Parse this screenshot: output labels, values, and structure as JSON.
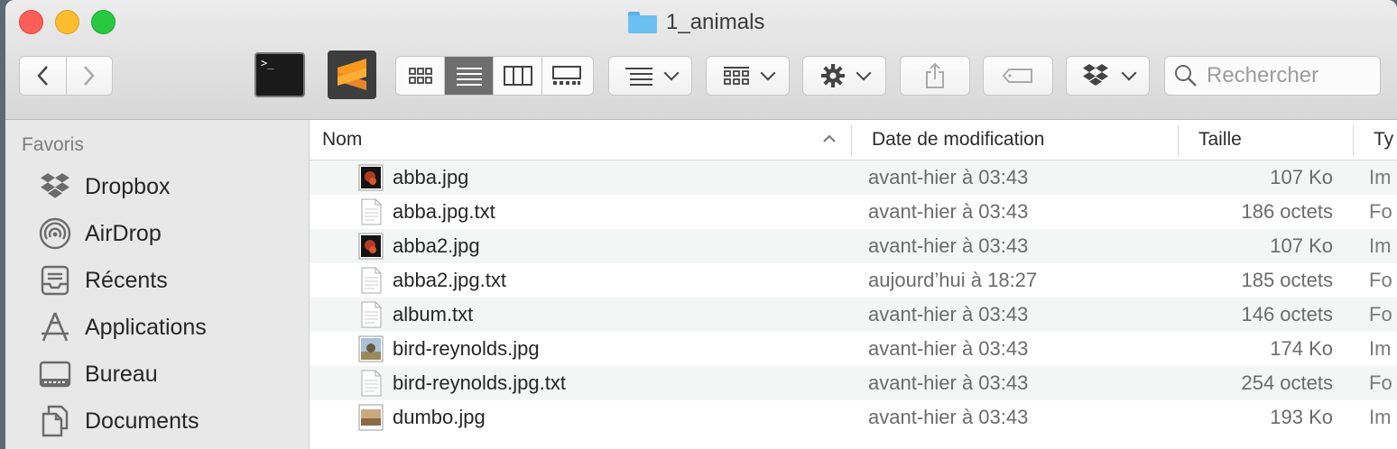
{
  "window": {
    "title": "1_animals"
  },
  "toolbar": {
    "back_label": "‹",
    "forward_label": "›",
    "terminal_prompt": ">_",
    "search_placeholder": "Rechercher"
  },
  "sidebar": {
    "heading": "Favoris",
    "items": [
      {
        "label": "Dropbox",
        "icon": "dropbox-icon"
      },
      {
        "label": "AirDrop",
        "icon": "airdrop-icon"
      },
      {
        "label": "Récents",
        "icon": "recents-icon"
      },
      {
        "label": "Applications",
        "icon": "applications-icon"
      },
      {
        "label": "Bureau",
        "icon": "desktop-icon"
      },
      {
        "label": "Documents",
        "icon": "documents-icon"
      }
    ]
  },
  "columns": {
    "name": "Nom",
    "date": "Date de modification",
    "size": "Taille",
    "type": "Ty"
  },
  "files": [
    {
      "name": "abba.jpg",
      "date": "avant-hier à 03:43",
      "size": "107 Ko",
      "type": "Im",
      "icon": "image-thumbnail-icon"
    },
    {
      "name": "abba.jpg.txt",
      "date": "avant-hier à 03:43",
      "size": "186 octets",
      "type": "Fo",
      "icon": "text-document-icon"
    },
    {
      "name": "abba2.jpg",
      "date": "avant-hier à 03:43",
      "size": "107 Ko",
      "type": "Im",
      "icon": "image-thumbnail-icon"
    },
    {
      "name": "abba2.jpg.txt",
      "date": "aujourd’hui à 18:27",
      "size": "185 octets",
      "type": "Fo",
      "icon": "text-document-icon"
    },
    {
      "name": "album.txt",
      "date": "avant-hier à 03:43",
      "size": "146 octets",
      "type": "Fo",
      "icon": "text-document-icon"
    },
    {
      "name": "bird-reynolds.jpg",
      "date": "avant-hier à 03:43",
      "size": "174 Ko",
      "type": "Im",
      "icon": "image-thumbnail-icon"
    },
    {
      "name": "bird-reynolds.jpg.txt",
      "date": "avant-hier à 03:43",
      "size": "254 octets",
      "type": "Fo",
      "icon": "text-document-icon"
    },
    {
      "name": "dumbo.jpg",
      "date": "avant-hier à 03:43",
      "size": "193 Ko",
      "type": "Im",
      "icon": "image-thumbnail-icon"
    }
  ]
}
